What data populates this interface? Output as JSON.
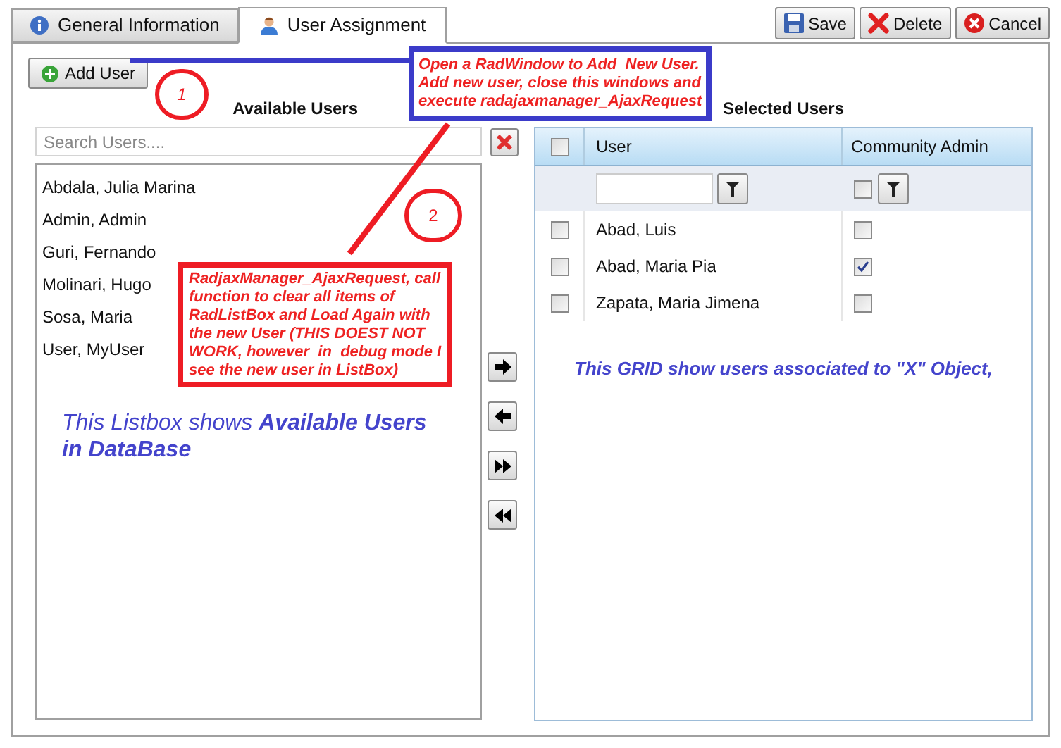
{
  "tabs": [
    {
      "label": "General Information",
      "kind": "info",
      "selected": false
    },
    {
      "label": "User Assignment",
      "kind": "user",
      "selected": true
    }
  ],
  "toolbar": [
    {
      "label": "Save",
      "kind": "save"
    },
    {
      "label": "Delete",
      "kind": "delete"
    },
    {
      "label": "Cancel",
      "kind": "cancel"
    }
  ],
  "add_user_button": "Add User",
  "available_users": {
    "title": "Available Users",
    "search": {
      "placeholder": "Search Users...."
    },
    "items": [
      "Abdala, Julia Marina",
      "Admin, Admin",
      "Guri, Fernando",
      "Molinari, Hugo",
      "Sosa, Maria",
      "User, MyUser"
    ]
  },
  "transfer_buttons": [
    {
      "kind": "move-right"
    },
    {
      "kind": "move-left"
    },
    {
      "kind": "all-right"
    },
    {
      "kind": "all-left"
    }
  ],
  "selected_users": {
    "title": "Selected Users",
    "select_all_checked": false,
    "columns": [
      "User",
      "Community Admin"
    ],
    "filter": {
      "admin_checked": false
    },
    "rows": [
      {
        "user": "Abad, Luis",
        "checked": false,
        "community_admin": false
      },
      {
        "user": "Abad, Maria Pia",
        "checked": false,
        "community_admin": true
      },
      {
        "user": "Zapata, Maria Jimena",
        "checked": false,
        "community_admin": false
      }
    ]
  },
  "annotations": {
    "step_1": "1",
    "step_2": "2",
    "note_1": [
      "Open a RadWindow to Add  New User.",
      "Add new user, close this windows and",
      "execute radajaxmanager_AjaxRequest"
    ],
    "note_2": [
      "RadjaxManager_AjaxRequest, call",
      "function to clear all items of",
      "RadListBox and Load Again with",
      "the new User (THIS DOEST NOT",
      "WORK, however  in  debug mode I",
      "see the new user in ListBox)"
    ],
    "listbox_note": [
      "This Listbox shows **Available Users**",
      "**in DataBase**"
    ],
    "grid_note": "This GRID show users associated to \"X\" Object,"
  }
}
